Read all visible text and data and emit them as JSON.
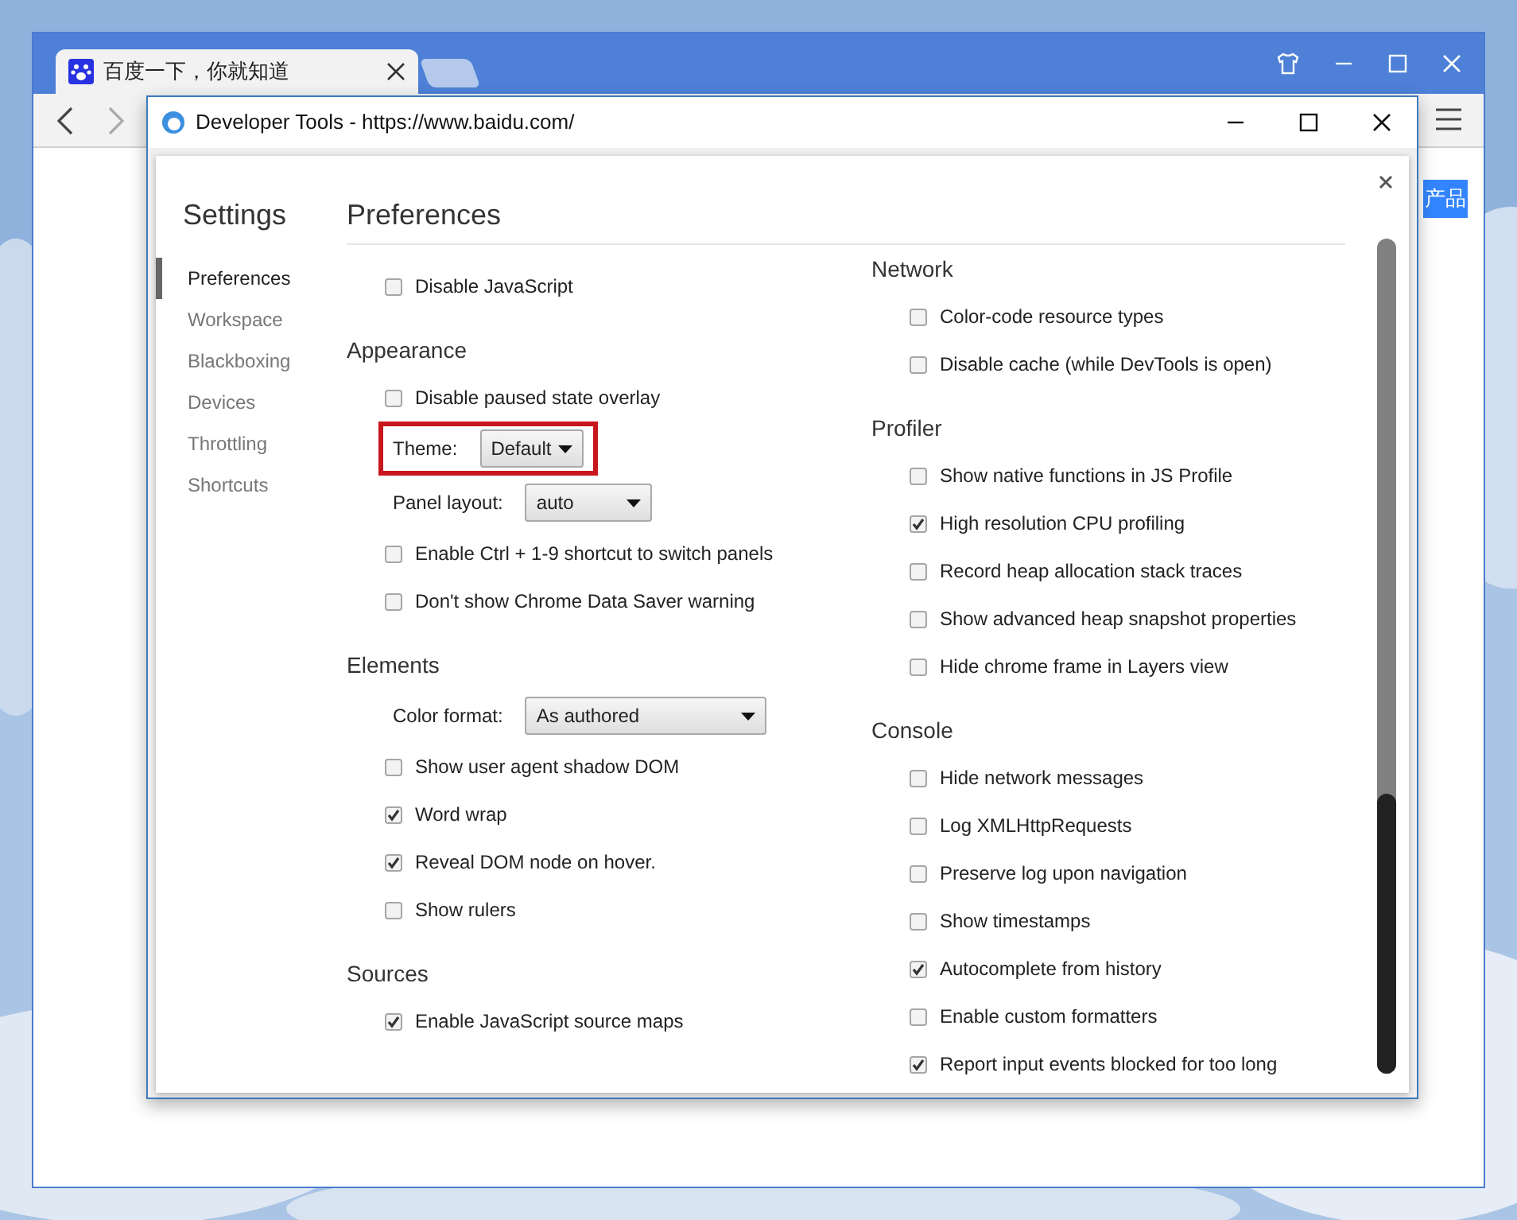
{
  "browser": {
    "tab": {
      "title": "百度一下，你就知道"
    },
    "page_button": "产品"
  },
  "devtools_window": {
    "title": "Developer Tools - https://www.baidu.com/"
  },
  "settings": {
    "title": "Settings",
    "sidebar": [
      {
        "label": "Preferences",
        "selected": true
      },
      {
        "label": "Workspace",
        "selected": false
      },
      {
        "label": "Blackboxing",
        "selected": false
      },
      {
        "label": "Devices",
        "selected": false
      },
      {
        "label": "Throttling",
        "selected": false
      },
      {
        "label": "Shortcuts",
        "selected": false
      }
    ],
    "heading": "Preferences",
    "columns": [
      [
        {
          "kind": "checkbox",
          "label": "Disable JavaScript",
          "checked": false
        },
        {
          "kind": "heading",
          "label": "Appearance"
        },
        {
          "kind": "checkbox",
          "label": "Disable paused state overlay",
          "checked": false
        },
        {
          "kind": "select",
          "label": "Theme:",
          "value": "Default",
          "highlighted": true
        },
        {
          "kind": "select",
          "label": "Panel layout:",
          "value": "auto",
          "highlighted": false
        },
        {
          "kind": "checkbox",
          "label": "Enable Ctrl + 1-9 shortcut to switch panels",
          "checked": false
        },
        {
          "kind": "checkbox",
          "label": "Don't show Chrome Data Saver warning",
          "checked": false
        },
        {
          "kind": "heading",
          "label": "Elements"
        },
        {
          "kind": "select",
          "label": "Color format:",
          "value": "As authored",
          "highlighted": false
        },
        {
          "kind": "checkbox",
          "label": "Show user agent shadow DOM",
          "checked": false
        },
        {
          "kind": "checkbox",
          "label": "Word wrap",
          "checked": true
        },
        {
          "kind": "checkbox",
          "label": "Reveal DOM node on hover.",
          "checked": true
        },
        {
          "kind": "checkbox",
          "label": "Show rulers",
          "checked": false
        },
        {
          "kind": "heading",
          "label": "Sources"
        },
        {
          "kind": "checkbox",
          "label": "Enable JavaScript source maps",
          "checked": true
        }
      ],
      [
        {
          "kind": "heading",
          "label": "Network"
        },
        {
          "kind": "checkbox",
          "label": "Color-code resource types",
          "checked": false
        },
        {
          "kind": "checkbox",
          "label": "Disable cache (while DevTools is open)",
          "checked": false
        },
        {
          "kind": "heading",
          "label": "Profiler"
        },
        {
          "kind": "checkbox",
          "label": "Show native functions in JS Profile",
          "checked": false
        },
        {
          "kind": "checkbox",
          "label": "High resolution CPU profiling",
          "checked": true
        },
        {
          "kind": "checkbox",
          "label": "Record heap allocation stack traces",
          "checked": false
        },
        {
          "kind": "checkbox",
          "label": "Show advanced heap snapshot properties",
          "checked": false
        },
        {
          "kind": "checkbox",
          "label": "Hide chrome frame in Layers view",
          "checked": false
        },
        {
          "kind": "heading",
          "label": "Console"
        },
        {
          "kind": "checkbox",
          "label": "Hide network messages",
          "checked": false
        },
        {
          "kind": "checkbox",
          "label": "Log XMLHttpRequests",
          "checked": false
        },
        {
          "kind": "checkbox",
          "label": "Preserve log upon navigation",
          "checked": false
        },
        {
          "kind": "checkbox",
          "label": "Show timestamps",
          "checked": false
        },
        {
          "kind": "checkbox",
          "label": "Autocomplete from history",
          "checked": true
        },
        {
          "kind": "checkbox",
          "label": "Enable custom formatters",
          "checked": false
        },
        {
          "kind": "checkbox",
          "label": "Report input events blocked for too long",
          "checked": true
        }
      ]
    ]
  }
}
